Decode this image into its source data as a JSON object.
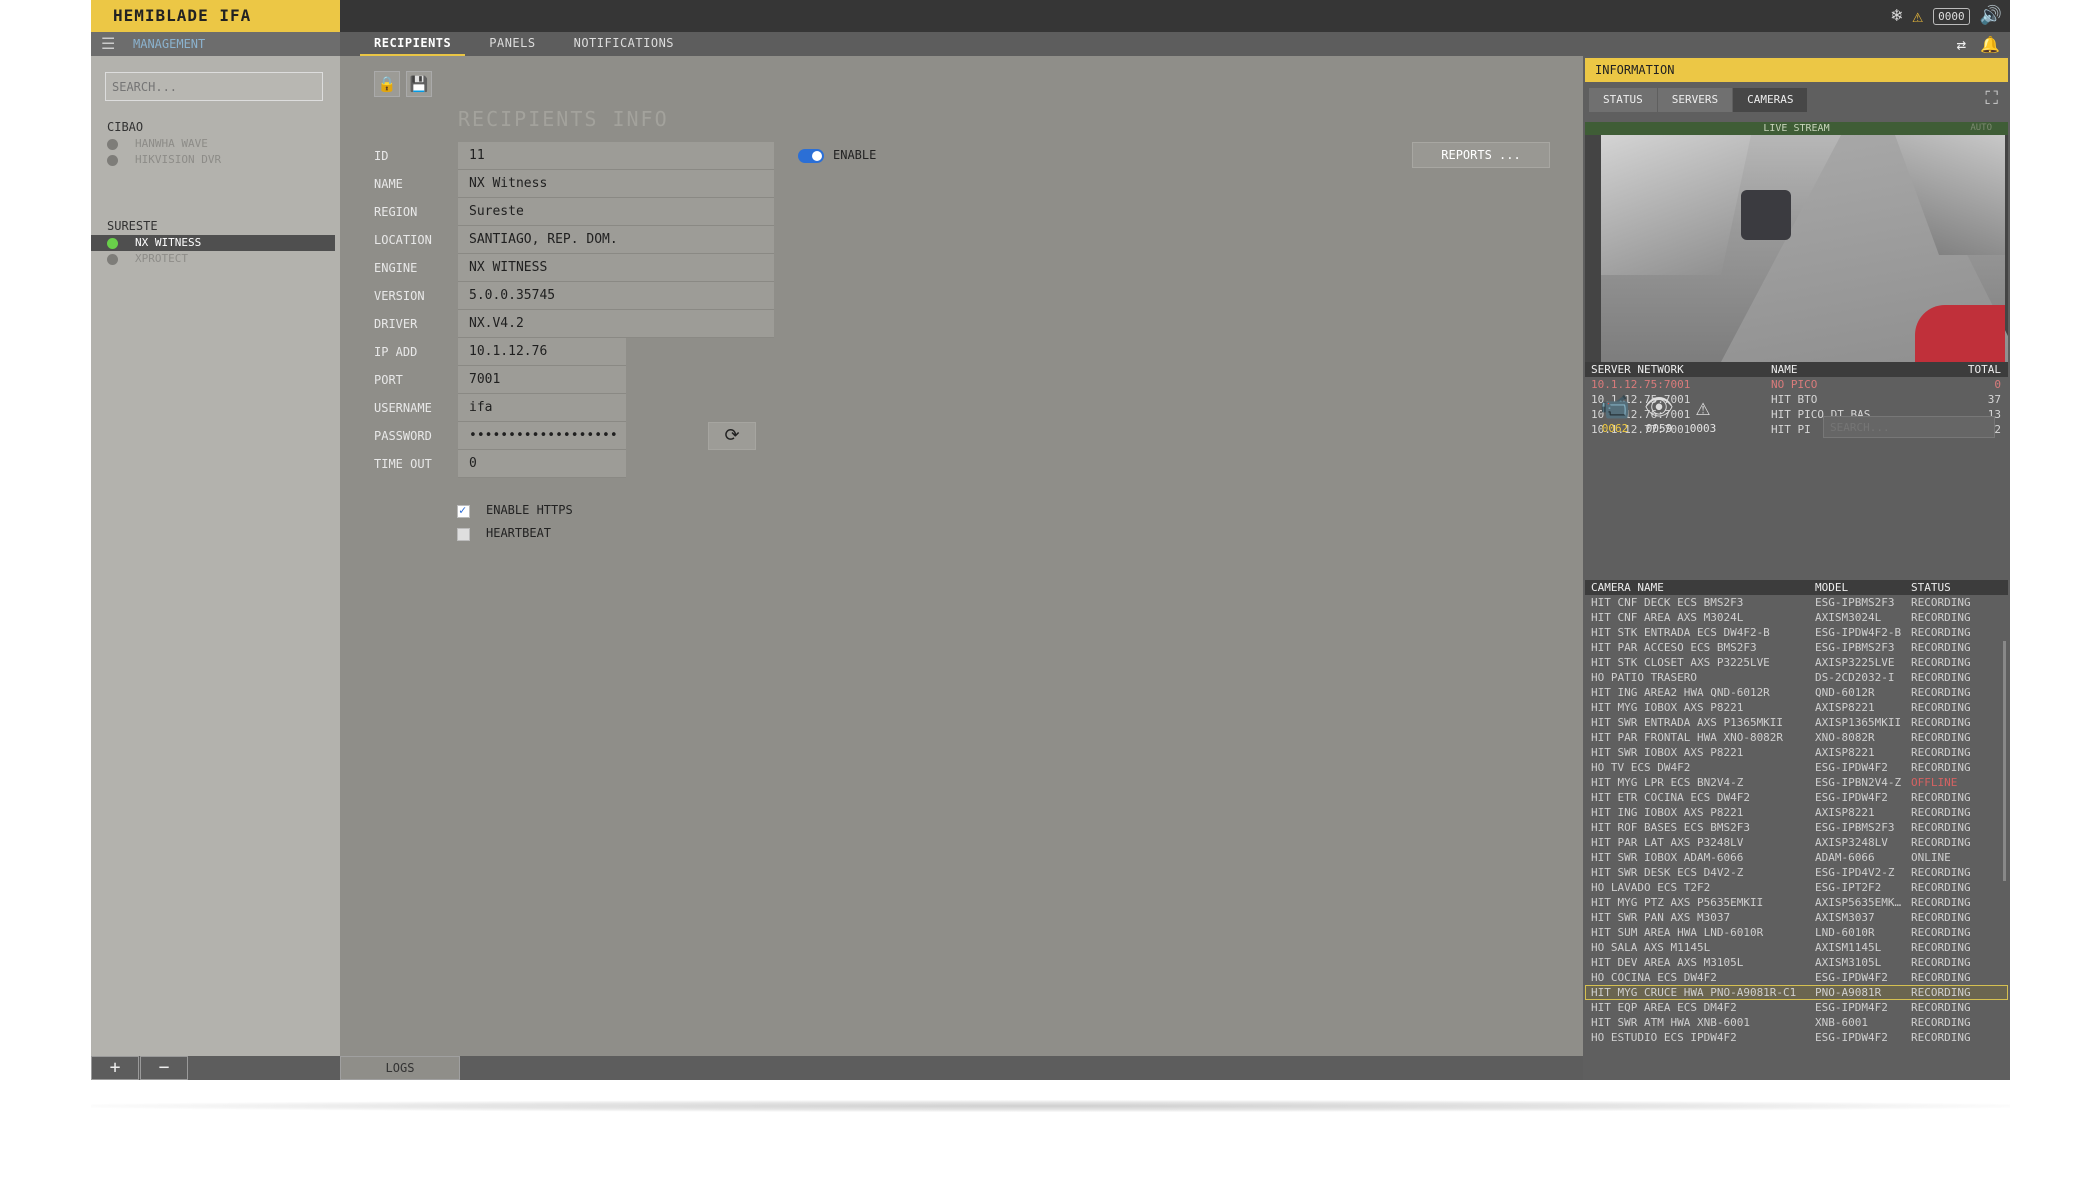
{
  "app": {
    "brand": "HEMIBLADE IFA",
    "counter": "0000"
  },
  "subbar": {
    "management": "MANAGEMENT",
    "tabs": [
      "RECIPIENTS",
      "PANELS",
      "NOTIFICATIONS"
    ]
  },
  "sidebar": {
    "search_placeholder": "SEARCH...",
    "groups": [
      {
        "name": "CIBAO",
        "items": [
          "HANWHA WAVE",
          "HIKVISION DVR"
        ]
      },
      {
        "name": "SURESTE",
        "items": [
          "NX WITNESS",
          "XPROTECT"
        ]
      }
    ],
    "selected": "NX WITNESS",
    "add": "+",
    "remove": "−"
  },
  "form": {
    "title": "RECIPIENTS INFO",
    "fields": [
      {
        "label": "ID",
        "value": "11"
      },
      {
        "label": "NAME",
        "value": "NX Witness"
      },
      {
        "label": "REGION",
        "value": "Sureste"
      },
      {
        "label": "LOCATION",
        "value": "SANTIAGO, REP. DOM."
      },
      {
        "label": "ENGINE",
        "value": "NX WITNESS"
      },
      {
        "label": "VERSION",
        "value": "5.0.0.35745"
      },
      {
        "label": "DRIVER",
        "value": "NX.V4.2"
      },
      {
        "label": "IP ADD",
        "value": "10.1.12.76"
      },
      {
        "label": "PORT",
        "value": "7001"
      },
      {
        "label": "USERNAME",
        "value": "ifa"
      },
      {
        "label": "PASSWORD",
        "value": "•••••••••••••••••••"
      },
      {
        "label": "TIME OUT",
        "value": "0"
      }
    ],
    "enable_label": "ENABLE",
    "reports_label": "REPORTS ...",
    "https_label": "ENABLE HTTPS",
    "heartbeat_label": "HEARTBEAT",
    "logs_label": "LOGS"
  },
  "info": {
    "title": "INFORMATION",
    "tabs": [
      "STATUS",
      "SERVERS",
      "CAMERAS"
    ],
    "live_label": "LIVE STREAM",
    "live_auto": "AUTO",
    "network_headers": [
      "SERVER NETWORK",
      "NAME",
      "TOTAL"
    ],
    "network_rows": [
      [
        "10.1.12.75:7001",
        "NO PICO",
        "0"
      ],
      [
        "10.1.12.75:7001",
        "HIT BTO",
        "37"
      ],
      [
        "10.1.12.76:7001",
        "HIT PICO DT BAS",
        "13"
      ],
      [
        "10.1.12.77:7001",
        "HIT PI",
        "12"
      ]
    ],
    "cam_counts": [
      "0062",
      "0059",
      "0003"
    ],
    "cam_search_placeholder": "SEARCH...",
    "camera_headers": [
      "CAMERA NAME",
      "MODEL",
      "STATUS"
    ],
    "cameras": [
      [
        "HIT CNF DECK ECS BMS2F3",
        "ESG-IPBMS2F3",
        "RECORDING"
      ],
      [
        "HIT CNF AREA AXS M3024L",
        "AXISM3024L",
        "RECORDING"
      ],
      [
        "HIT STK ENTRADA ECS DW4F2-B",
        "ESG-IPDW4F2-B",
        "RECORDING"
      ],
      [
        "HIT PAR ACCESO ECS BMS2F3",
        "ESG-IPBMS2F3",
        "RECORDING"
      ],
      [
        "HIT STK CLOSET AXS P3225LVE",
        "AXISP3225LVE",
        "RECORDING"
      ],
      [
        "HO PATIO TRASERO",
        "DS-2CD2032-I",
        "RECORDING"
      ],
      [
        "HIT ING AREA2 HWA QND-6012R",
        "QND-6012R",
        "RECORDING"
      ],
      [
        "HIT MYG IOBOX AXS P8221",
        "AXISP8221",
        "RECORDING"
      ],
      [
        "HIT SWR ENTRADA AXS P1365MKII",
        "AXISP1365MKII",
        "RECORDING"
      ],
      [
        "HIT PAR FRONTAL HWA XNO-8082R",
        "XNO-8082R",
        "RECORDING"
      ],
      [
        "HIT SWR IOBOX AXS P8221",
        "AXISP8221",
        "RECORDING"
      ],
      [
        "HO TV ECS DW4F2",
        "ESG-IPDW4F2",
        "RECORDING"
      ],
      [
        "HIT MYG LPR ECS BN2V4-Z",
        "ESG-IPBN2V4-Z",
        "OFFLINE"
      ],
      [
        "HIT ETR COCINA ECS DW4F2",
        "ESG-IPDW4F2",
        "RECORDING"
      ],
      [
        "HIT ING IOBOX AXS P8221",
        "AXISP8221",
        "RECORDING"
      ],
      [
        "HIT ROF BASES ECS BMS2F3",
        "ESG-IPBMS2F3",
        "RECORDING"
      ],
      [
        "HIT PAR LAT AXS P3248LV",
        "AXISP3248LV",
        "RECORDING"
      ],
      [
        "HIT SWR IOBOX ADAM-6066",
        "ADAM-6066",
        "ONLINE"
      ],
      [
        "HIT SWR DESK ECS D4V2-Z",
        "ESG-IPD4V2-Z",
        "RECORDING"
      ],
      [
        "HO LAVADO ECS T2F2",
        "ESG-IPT2F2",
        "RECORDING"
      ],
      [
        "HIT MYG PTZ AXS P5635EMKII",
        "AXISP5635EMK…",
        "RECORDING"
      ],
      [
        "HIT SWR PAN AXS M3037",
        "AXISM3037",
        "RECORDING"
      ],
      [
        "HIT SUM AREA HWA LND-6010R",
        "LND-6010R",
        "RECORDING"
      ],
      [
        "HO SALA AXS M1145L",
        "AXISM1145L",
        "RECORDING"
      ],
      [
        "HIT DEV AREA AXS M3105L",
        "AXISM3105L",
        "RECORDING"
      ],
      [
        "HO COCINA ECS DW4F2",
        "ESG-IPDW4F2",
        "RECORDING"
      ],
      [
        "HIT MYG CRUCE HWA PNO-A9081R-C1",
        "PNO-A9081R",
        "RECORDING"
      ],
      [
        "HIT EQP AREA ECS DM4F2",
        "ESG-IPDM4F2",
        "RECORDING"
      ],
      [
        "HIT SWR ATM HWA XNB-6001",
        "XNB-6001",
        "RECORDING"
      ],
      [
        "HO ESTUDIO ECS IPDW4F2",
        "ESG-IPDW4F2",
        "RECORDING"
      ]
    ],
    "selected_camera_index": 26
  }
}
